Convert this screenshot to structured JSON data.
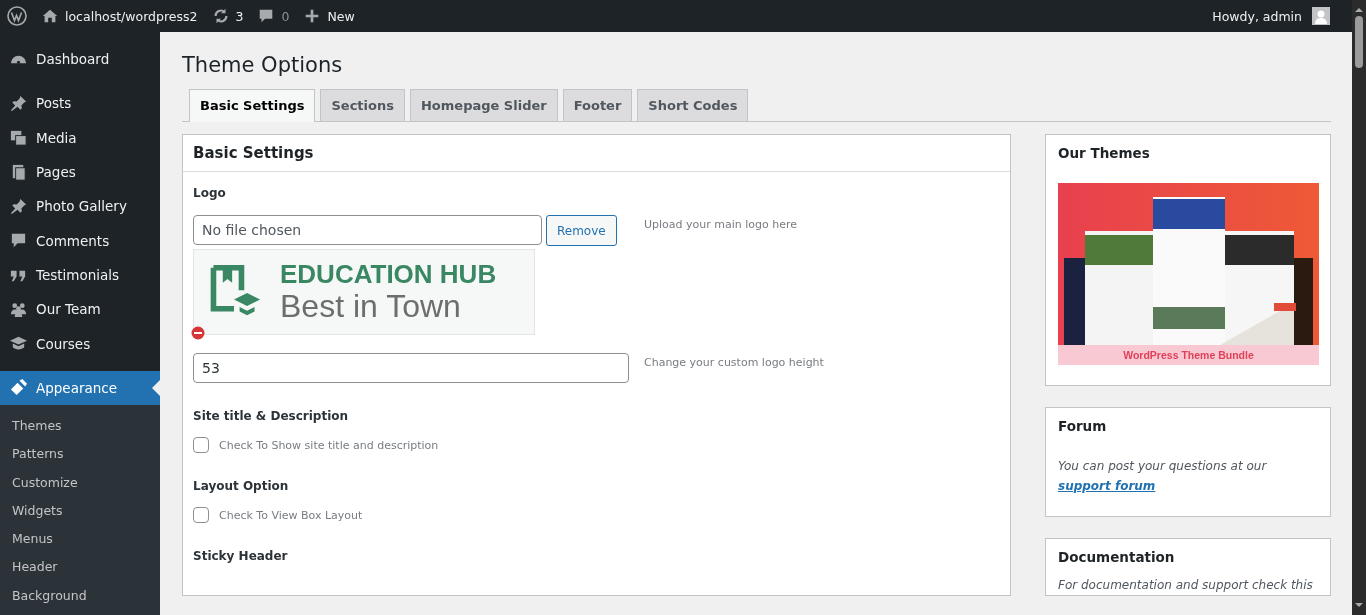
{
  "admin_bar": {
    "site": "localhost/wordpress2",
    "updates": "3",
    "comments": "0",
    "new": "New",
    "greeting": "Howdy, admin"
  },
  "menu": [
    {
      "label": "Dashboard",
      "selected": false
    },
    {
      "label": "Posts",
      "selected": false
    },
    {
      "label": "Media",
      "selected": false
    },
    {
      "label": "Pages",
      "selected": false
    },
    {
      "label": "Photo Gallery",
      "selected": false
    },
    {
      "label": "Comments",
      "selected": false
    },
    {
      "label": "Testimonials",
      "selected": false
    },
    {
      "label": "Our Team",
      "selected": false
    },
    {
      "label": "Courses",
      "selected": false
    },
    {
      "label": "Appearance",
      "selected": true
    }
  ],
  "submenu": [
    {
      "label": "Themes",
      "selected": false
    },
    {
      "label": "Patterns",
      "selected": false
    },
    {
      "label": "Customize",
      "selected": false
    },
    {
      "label": "Widgets",
      "selected": false
    },
    {
      "label": "Menus",
      "selected": false
    },
    {
      "label": "Header",
      "selected": false
    },
    {
      "label": "Background",
      "selected": false
    }
  ],
  "page_title": "Theme Options",
  "tabs": [
    {
      "label": "Basic Settings",
      "selected": true
    },
    {
      "label": "Sections",
      "selected": false
    },
    {
      "label": "Homepage Slider",
      "selected": false
    },
    {
      "label": "Footer",
      "selected": false
    },
    {
      "label": "Short Codes",
      "selected": false
    }
  ],
  "panel": {
    "title": "Basic Settings",
    "logo": {
      "label": "Logo",
      "placeholder": "No file chosen",
      "remove": "Remove",
      "hint": "Upload your main logo here",
      "preview_title": "EDUCATION HUB",
      "preview_tagline": "Best in Town"
    },
    "logo_height": {
      "value": "53",
      "hint": "Change your custom logo height"
    },
    "options": [
      {
        "label": "Site title & Description",
        "checkbox": "Check To Show site title and description",
        "checked": false
      },
      {
        "label": "Layout Option",
        "checkbox": "Check To View Box Layout",
        "checked": false
      }
    ],
    "next_label": "Sticky Header"
  },
  "widgets": {
    "themes": {
      "title": "Our Themes",
      "caption": "WordPress Theme Bundle"
    },
    "forum": {
      "title": "Forum",
      "text": "You can post your questions at our ",
      "link": "support forum"
    },
    "docs": {
      "title": "Documentation",
      "text": "For documentation and support check this"
    }
  }
}
